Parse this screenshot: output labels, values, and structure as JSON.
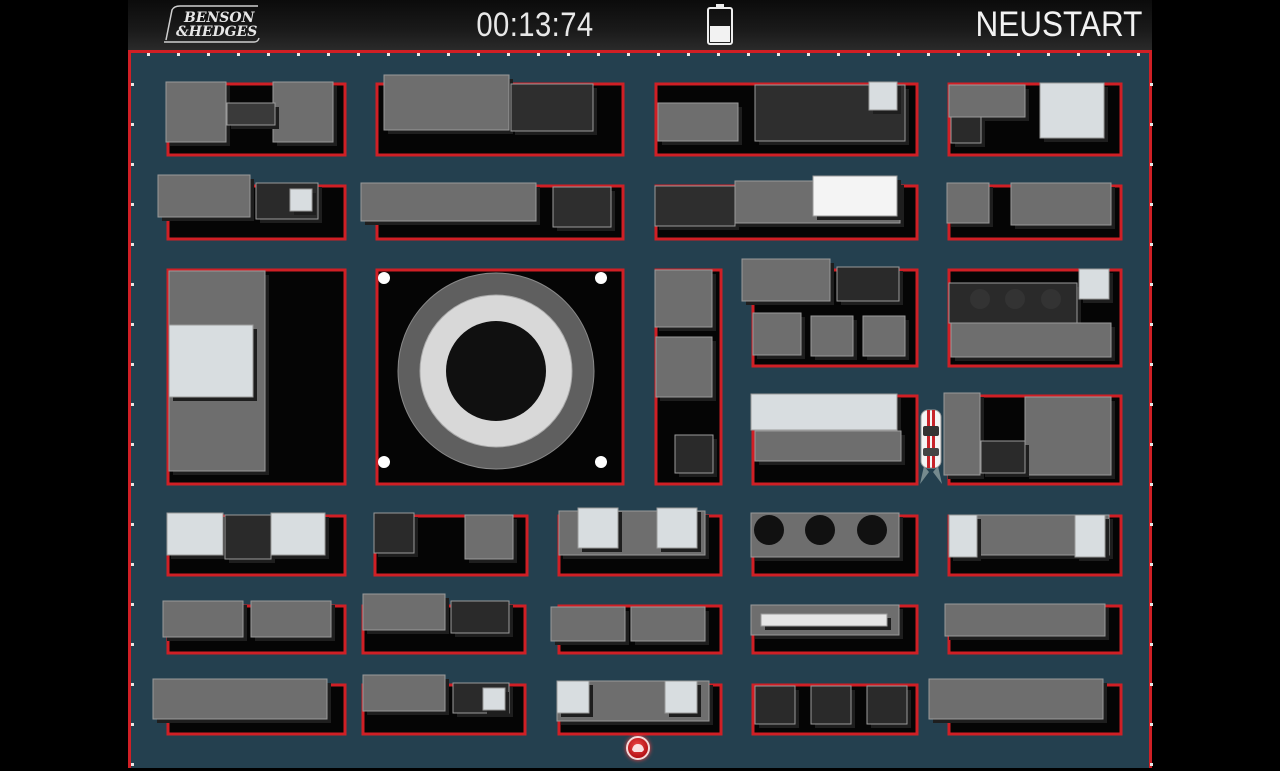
{
  "header": {
    "brand_line1": "BENSON",
    "brand_line2": "&HEDGES",
    "timer": "00:13:74",
    "restart_label": "NEUSTART",
    "battery_icon": "battery-icon"
  },
  "colors": {
    "board": "#24404f",
    "wall": "#d01f25",
    "roof": "#6e6e6e",
    "roof_light": "#d8dde0",
    "roof_dark": "#2a2a2a",
    "block_bg": "#050505"
  },
  "game": {
    "player": "car-icon",
    "goal": "goal-marker-icon"
  }
}
